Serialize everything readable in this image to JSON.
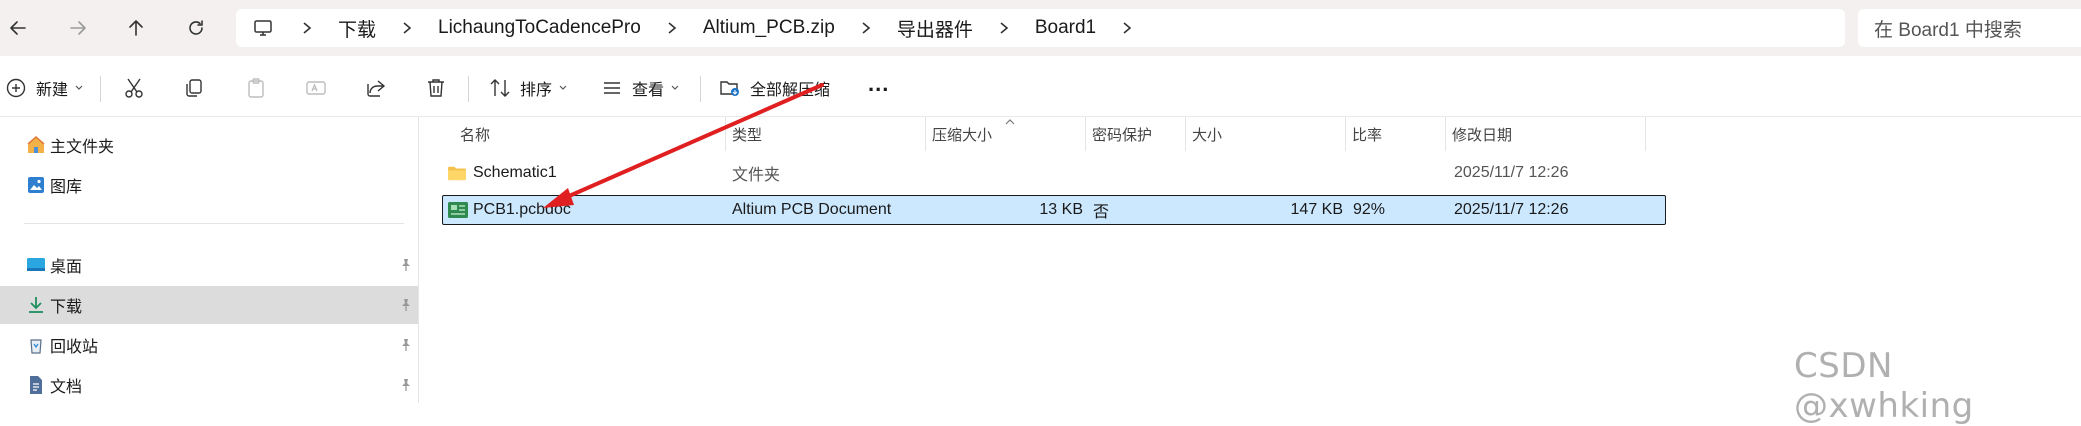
{
  "nav": {
    "back_icon": "arrow-left-icon",
    "forward_icon": "arrow-right-icon",
    "up_icon": "arrow-up-icon",
    "refresh_icon": "refresh-icon"
  },
  "breadcrumb": {
    "items": [
      "下载",
      "LichaungToCadencePro",
      "Altium_PCB.zip",
      "导出器件",
      "Board1"
    ]
  },
  "search": {
    "placeholder": "在 Board1 中搜索"
  },
  "toolbar": {
    "new_label": "新建",
    "sort_label": "排序",
    "view_label": "查看",
    "extract_all_label": "全部解压缩",
    "more_label": "..."
  },
  "sidebar": {
    "items": [
      {
        "label": "主文件夹",
        "icon": "home-icon"
      },
      {
        "label": "图库",
        "icon": "gallery-icon"
      },
      {
        "label": "桌面",
        "icon": "desktop-icon",
        "pinned": true
      },
      {
        "label": "下载",
        "icon": "download-icon",
        "pinned": true,
        "selected": true
      },
      {
        "label": "回收站",
        "icon": "recycle-bin-icon",
        "pinned": true
      },
      {
        "label": "文档",
        "icon": "document-icon",
        "pinned": true
      }
    ]
  },
  "columns": [
    "名称",
    "类型",
    "压缩大小",
    "密码保护",
    "大小",
    "比率",
    "修改日期"
  ],
  "files": [
    {
      "name": "Schematic1",
      "type": "文件夹",
      "compressed": "",
      "password": "",
      "size": "",
      "ratio": "",
      "modified": "2025/11/7 12:26",
      "icon": "folder-icon"
    },
    {
      "name": "PCB1.pcbdoc",
      "type": "Altium PCB Document",
      "compressed": "13 KB",
      "password": "否",
      "size": "147 KB",
      "ratio": "92%",
      "modified": "2025/11/7 12:26",
      "icon": "pcb-file-icon",
      "selected": true
    }
  ],
  "colors": {
    "selection": "#cce8ff",
    "annotation_arrow": "#e02020",
    "sidebar_selected": "#dcdcdc"
  },
  "watermark": "CSDN @xwhking"
}
